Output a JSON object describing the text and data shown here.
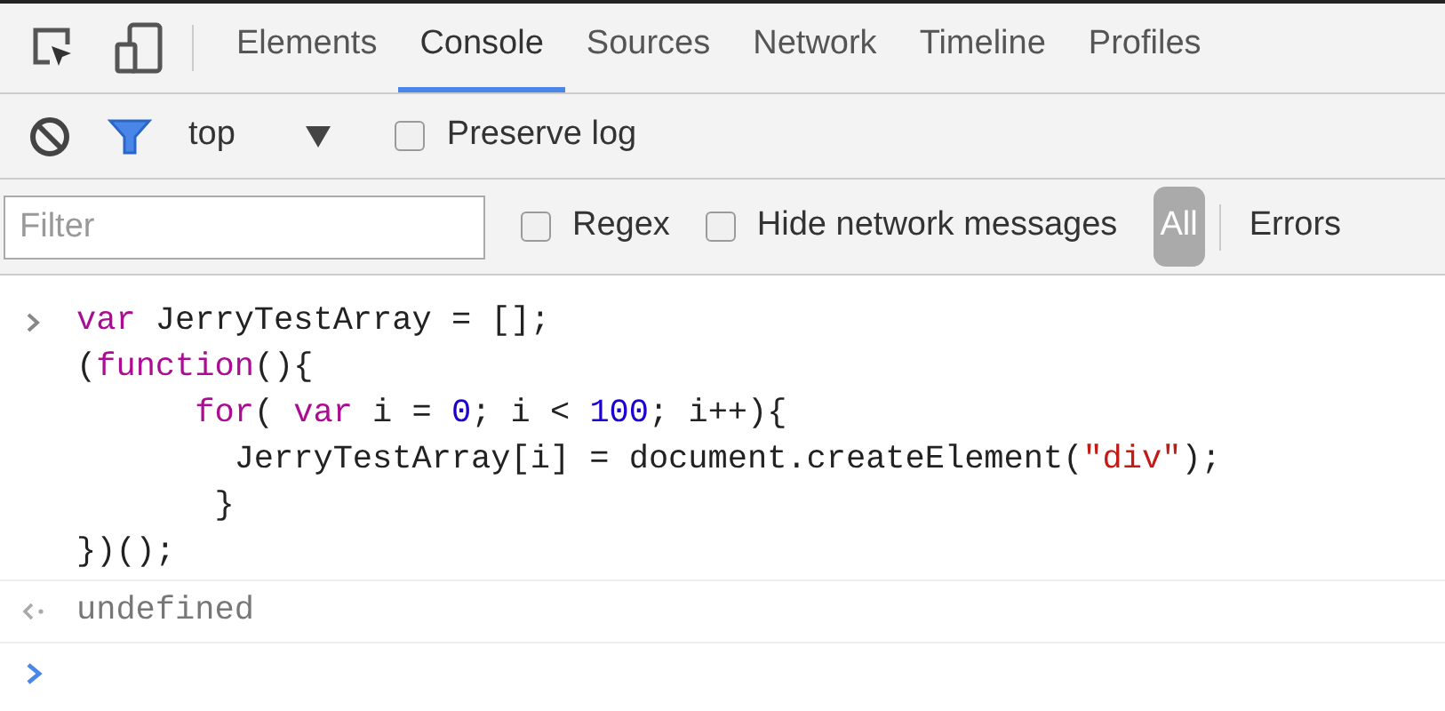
{
  "tabs": [
    {
      "label": "Elements",
      "selected": false
    },
    {
      "label": "Console",
      "selected": true
    },
    {
      "label": "Sources",
      "selected": false
    },
    {
      "label": "Network",
      "selected": false
    },
    {
      "label": "Timeline",
      "selected": false
    },
    {
      "label": "Profiles",
      "selected": false
    }
  ],
  "toolbar": {
    "context": "top",
    "preserve_log": {
      "label": "Preserve log",
      "checked": false
    }
  },
  "filter_bar": {
    "placeholder": "Filter",
    "regex": {
      "label": "Regex",
      "checked": false
    },
    "hide_network": {
      "label": "Hide network messages",
      "checked": false
    },
    "levels": [
      {
        "label": "All",
        "selected": true
      },
      {
        "label": "Errors",
        "selected": false
      }
    ]
  },
  "console": {
    "input_lines": [
      [
        {
          "kind": "keyword",
          "text": "var"
        },
        {
          "kind": "plain",
          "text": " JerryTestArray = [];"
        }
      ],
      [
        {
          "kind": "plain",
          "text": "("
        },
        {
          "kind": "keyword",
          "text": "function"
        },
        {
          "kind": "plain",
          "text": "(){"
        }
      ],
      [
        {
          "kind": "keyword",
          "text": "      for"
        },
        {
          "kind": "plain",
          "text": "( "
        },
        {
          "kind": "keyword",
          "text": "var"
        },
        {
          "kind": "plain",
          "text": " i = "
        },
        {
          "kind": "number",
          "text": "0"
        },
        {
          "kind": "plain",
          "text": "; i < "
        },
        {
          "kind": "number",
          "text": "100"
        },
        {
          "kind": "plain",
          "text": "; i++){"
        }
      ],
      [
        {
          "kind": "plain",
          "text": "        JerryTestArray[i] = document.createElement("
        },
        {
          "kind": "string",
          "text": "\"div\""
        },
        {
          "kind": "plain",
          "text": ");"
        }
      ],
      [
        {
          "kind": "plain",
          "text": "       }"
        }
      ],
      [
        {
          "kind": "plain",
          "text": "})();"
        }
      ]
    ],
    "result": "undefined"
  }
}
